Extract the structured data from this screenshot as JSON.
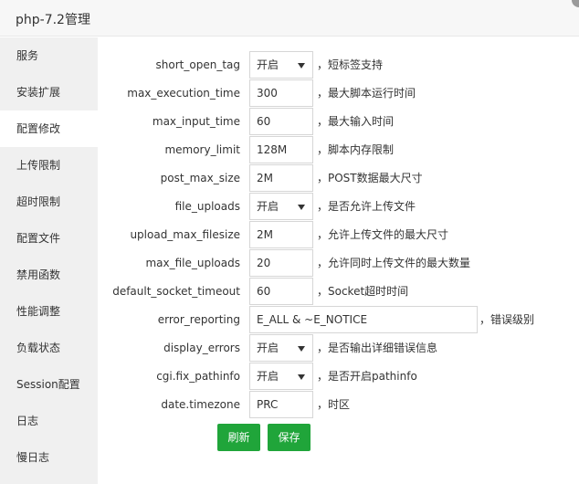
{
  "window": {
    "title": "php-7.2管理"
  },
  "sidebar": {
    "items": [
      {
        "label": "服务"
      },
      {
        "label": "安装扩展"
      },
      {
        "label": "配置修改"
      },
      {
        "label": "上传限制"
      },
      {
        "label": "超时限制"
      },
      {
        "label": "配置文件"
      },
      {
        "label": "禁用函数"
      },
      {
        "label": "性能调整"
      },
      {
        "label": "负载状态"
      },
      {
        "label": "Session配置"
      },
      {
        "label": "日志"
      },
      {
        "label": "慢日志"
      }
    ],
    "active_index": 2
  },
  "form": {
    "rows": [
      {
        "label": "short_open_tag",
        "type": "select",
        "value": "开启",
        "hint": "，短标签支持"
      },
      {
        "label": "max_execution_time",
        "type": "input",
        "value": "300",
        "hint": "，最大脚本运行时间"
      },
      {
        "label": "max_input_time",
        "type": "input",
        "value": "60",
        "hint": "，最大输入时间"
      },
      {
        "label": "memory_limit",
        "type": "input",
        "value": "128M",
        "hint": "，脚本内存限制"
      },
      {
        "label": "post_max_size",
        "type": "input",
        "value": "2M",
        "hint": "，POST数据最大尺寸"
      },
      {
        "label": "file_uploads",
        "type": "select",
        "value": "开启",
        "hint": "，是否允许上传文件"
      },
      {
        "label": "upload_max_filesize",
        "type": "input",
        "value": "2M",
        "hint": "，允许上传文件的最大尺寸"
      },
      {
        "label": "max_file_uploads",
        "type": "input",
        "value": "20",
        "hint": "，允许同时上传文件的最大数量"
      },
      {
        "label": "default_socket_timeout",
        "type": "input",
        "value": "60",
        "hint": "，Socket超时时间"
      },
      {
        "label": "error_reporting",
        "type": "input_wide",
        "value": "E_ALL & ~E_NOTICE",
        "hint": "，错误级别"
      },
      {
        "label": "display_errors",
        "type": "select",
        "value": "开启",
        "hint": "，是否输出详细错误信息"
      },
      {
        "label": "cgi.fix_pathinfo",
        "type": "select",
        "value": "开启",
        "hint": "，是否开启pathinfo"
      },
      {
        "label": "date.timezone",
        "type": "input",
        "value": "PRC",
        "hint": "，时区"
      }
    ]
  },
  "buttons": {
    "refresh": "刷新",
    "save": "保存"
  },
  "colors": {
    "accent": "#20a53a",
    "sidebar_bg": "#f0f0f0",
    "titlebar_bg": "#f7f7f7"
  }
}
